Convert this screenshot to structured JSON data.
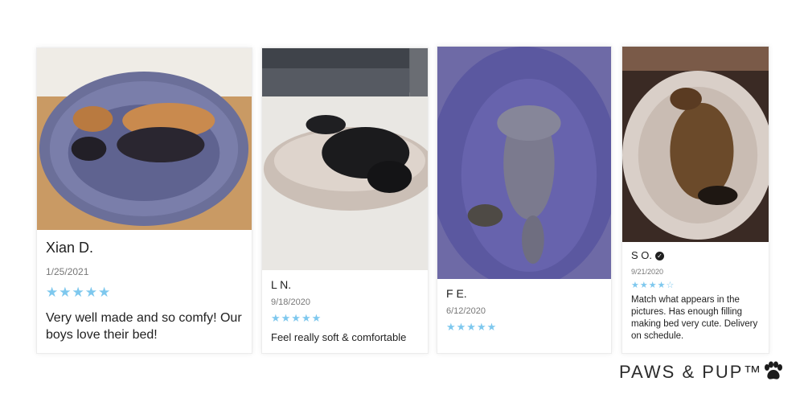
{
  "reviews": [
    {
      "name": "Xian D.",
      "date": "1/25/2021",
      "rating": 5,
      "stars": "★★★★★",
      "text": "Very well made and so comfy! Our boys love their bed!",
      "photo_icon": "two-dogs-on-grey-fluffy-bed",
      "verified": false
    },
    {
      "name": "L N.",
      "date": "9/18/2020",
      "rating": 5,
      "stars": "★★★★★",
      "text": "Feel really soft & comfortable",
      "photo_icon": "black-dog-on-beige-fluffy-bed",
      "verified": false
    },
    {
      "name": "F E.",
      "date": "6/12/2020",
      "rating": 5,
      "stars": "★★★★★",
      "text": "",
      "photo_icon": "dog-on-back-on-purple-fluffy-bed",
      "verified": false
    },
    {
      "name": "S O.",
      "date": "9/21/2020",
      "rating": 4,
      "stars": "★★★★☆",
      "text": "Match what appears in the pictures. Has enough filling making bed very cute. Delivery on schedule.",
      "photo_icon": "brown-dog-on-beige-fluffy-bed",
      "verified": true
    }
  ],
  "brand": {
    "name": "PAWS & PUP™",
    "icon": "paw-icon"
  },
  "colors": {
    "star": "#7ec8ee",
    "text": "#1f1f1f",
    "date": "#777777",
    "bed_grey_blue": "#6b6f99",
    "bed_beige": "#d9cfc8"
  }
}
